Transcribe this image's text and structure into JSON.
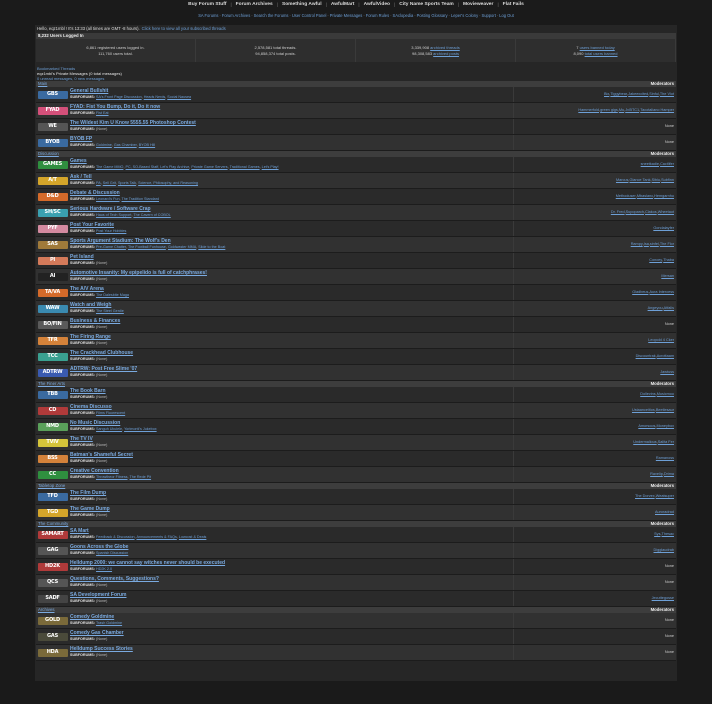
{
  "top_links": [
    "Buy Forum Stuff",
    "Forum Archives",
    "Something Awful",
    "AwfulMart",
    "AwfulVideo",
    "City Name Sports Team",
    "Movieweaver",
    "Flat Fails"
  ],
  "nav_links": [
    "SA Forums",
    "Forum Archives",
    "Search the Forums",
    "User Control Panel",
    "Private Messages",
    "Forum Rules",
    "SAclopedia",
    "Posting Glossary",
    "Leper's Colony",
    "Support",
    "Log Out"
  ],
  "greeting": {
    "text": "Hello, eqz1mbl ! It's 13:33 (all times are GMT -8 hours).",
    "link": "Click here to view all your subscribed threads"
  },
  "stats": {
    "header": "8,232 Users Logged In",
    "cells": [
      {
        "line1": "6,861 registered users logged in.",
        "line2": "111,760 users total."
      },
      {
        "line1": "2,578,581 total threads.",
        "line2": "94,858,374 total posts."
      },
      {
        "line1": "3,339,908",
        "link1": "archived threads",
        "line2": "98,308,583",
        "link2": "archived posts"
      },
      {
        "line1": "7",
        "link1": "users banned today",
        "line2": "8,090",
        "link2": "total users banned"
      }
    ]
  },
  "pm": {
    "bookmarks": "Bookmarked Threads",
    "title": "eqz1mbl's Private Messages (0 total messages)",
    "sub": "0 unread messages, 0 new messages"
  },
  "labels": {
    "moderators": "Moderators",
    "subforums": "SUBFORUMS:",
    "none": "(None)",
    "mods_none": "None"
  },
  "categories": [
    {
      "name": "Main",
      "forums": [
        {
          "tag": "GBS",
          "color": "#3a6aa0",
          "title": "General Bullshit",
          "subforums": [
            "SA's Front Page Discussion",
            "Heads Nerds",
            "Social Nausea"
          ],
          "mods": [
            "Bix",
            "Tiggybear",
            "Jakeexcited",
            "Sinful",
            "The Vlot"
          ]
        },
        {
          "tag": "FYAD",
          "color": "#d4507a",
          "title": "FYAD: Fist You Bump, Do it, Do it now",
          "subforums": [
            "Fist Eat"
          ],
          "mods": [
            "Hammerfold",
            "green gigs",
            "Mu",
            "Jvl5TC1",
            "Tacotaliano Hamper"
          ]
        },
        {
          "tag": "WE",
          "color": "#555555",
          "title": "The Wildest Kim U Know 5555.55 Photoshop Contest",
          "subforums": [],
          "mods": []
        },
        {
          "tag": "BYOB",
          "color": "#3a6aa0",
          "title": "BYOB FP",
          "subforums": [
            "Goldmine",
            "Gas Chamber",
            "BYOB Hill"
          ],
          "mods": []
        }
      ]
    },
    {
      "name": "Discussion",
      "forums": [
        {
          "tag": "GAMES",
          "color": "#2f8f3f",
          "title": "Games",
          "subforums": [
            "The Game MMO",
            "PC, SO-Based Staff, Let's Play Archive",
            "Private Game Servers",
            "Traditional Games",
            "Let's Play!"
          ],
          "mods": [
            "sneetkadie",
            "Cactlifer"
          ]
        },
        {
          "tag": "A/T",
          "color": "#d4a52a",
          "title": "Ask / Tell",
          "subforums": [
            "PA",
            "Sell Grit",
            "Sports Talk",
            "Science, Philosophy, and Reasoning"
          ],
          "mods": [
            "Marcus",
            "Glance Tank",
            "Sibiu",
            "Subfinn"
          ]
        },
        {
          "tag": "D&D",
          "color": "#d46a2a",
          "title": "Debate & Discussion",
          "subforums": [
            "Leonard's Fun",
            "The Tradition Standard"
          ],
          "mods": [
            "Methoduser",
            "Mbaslanc",
            "Hemgarnhu"
          ]
        },
        {
          "tag": "SH/SC",
          "color": "#3aa0b0",
          "title": "Serious Hardware / Software Crap",
          "subforums": [
            "Haus of Tech Support",
            "The Cavern of COBOL"
          ],
          "mods": [
            "Dr. Fred",
            "Supoparch",
            "Clakos",
            "Wheetaot"
          ]
        },
        {
          "tag": "PYF",
          "color": "#d48aa0",
          "title": "Post Your Favorite",
          "subforums": [
            "Post Your Hobbies"
          ],
          "mods": [
            "Gondalayfer"
          ]
        },
        {
          "tag": "SAS",
          "color": "#a07a3a",
          "title": "Sports Argument Stadium: The Wolf's Den",
          "subforums": [
            "Pre-Game Chatter",
            "The Football Funhouse",
            "Goldwaster MMA",
            "Slide to the Boat"
          ],
          "mods": [
            "Rampy",
            "Isa",
            "sinfel",
            "The Flor"
          ]
        },
        {
          "tag": "PI",
          "color": "#d47a5a",
          "title": "Pet Island",
          "subforums": [],
          "mods": [
            "Concey",
            "Thaba"
          ]
        },
        {
          "tag": "AI",
          "color": "#222222",
          "title": "Automotive Insanity: My epipelido is full of catchphrases!",
          "subforums": [],
          "mods": [
            "Mersan"
          ]
        },
        {
          "tag": "TA/VA",
          "color": "#d46a2a",
          "title": "The A/V Arena",
          "subforums": [
            "The Dalesbite Maga"
          ],
          "mods": [
            "Gladbeus",
            "Aura Intercess"
          ]
        },
        {
          "tag": "WAW",
          "color": "#3a8ab0",
          "title": "Watch and Weigh",
          "subforums": [
            "The Steel Gerdie"
          ],
          "mods": [
            "Angeyou",
            "Atfalis"
          ]
        },
        {
          "tag": "BO/FIN",
          "color": "#5a5a5a",
          "title": "Business & Finances",
          "subforums": [],
          "mods": []
        },
        {
          "tag": "TFR",
          "color": "#d4823a",
          "title": "The Firing Range",
          "subforums": [],
          "mods": [
            "Leopold 4 Cker"
          ]
        },
        {
          "tag": "TCC",
          "color": "#3aa090",
          "title": "The Crackhead Clubhouse",
          "subforums": [],
          "mods": [
            "Discountrak",
            "Acrottaam"
          ]
        },
        {
          "tag": "ADTRW",
          "color": "#3a5ab0",
          "title": "ADTRW: Post Free Slime '07",
          "subforums": [],
          "mods": [
            "Jawtuss"
          ]
        }
      ]
    },
    {
      "name": "The Finer Arts",
      "forums": [
        {
          "tag": "TBB",
          "color": "#3a6aa0",
          "title": "The Book Barn",
          "subforums": [],
          "mods": [
            "Dollevins",
            "Musicmoo"
          ]
        },
        {
          "tag": "CD",
          "color": "#b03a3a",
          "title": "Cinema Discusso",
          "subforums": [
            "Films Fluorescent"
          ],
          "mods": [
            "Ustaanceitios",
            "Beetlesaur"
          ]
        },
        {
          "tag": "NMD",
          "color": "#5aa05a",
          "title": "No Music Discussion",
          "subforums": [
            "Sanguh Ukulele",
            "Yorimonti's Jukebox"
          ],
          "mods": [
            "Amorsoos",
            "Moneybox"
          ]
        },
        {
          "tag": "TVIV",
          "color": "#d4c43a",
          "title": "The TV IV",
          "subforums": [],
          "mods": [
            "Undermalious",
            "Salita Fer"
          ]
        },
        {
          "tag": "BSS",
          "color": "#d4823a",
          "title": "Batman's Shameful Secret",
          "subforums": [],
          "mods": [
            "Ramanoss"
          ]
        },
        {
          "tag": "CC",
          "color": "#2f8f3f",
          "title": "Creative Convention",
          "subforums": [
            "Throwtheor Fitness",
            "The Rede Pit"
          ],
          "mods": [
            "Ravelip",
            "Drima"
          ]
        }
      ]
    },
    {
      "name": "Tabletop Zone",
      "forums": [
        {
          "tag": "TFD",
          "color": "#3a6aa0",
          "title": "The Film Dump",
          "subforums": [],
          "mods": [
            "The Dorvex",
            "Weatsuper"
          ]
        },
        {
          "tag": "TGD",
          "color": "#d4a52a",
          "title": "The Game Dump",
          "subforums": [],
          "mods": [
            "Auroradrad"
          ]
        }
      ]
    },
    {
      "name": "The Community",
      "forums": [
        {
          "tag": "SAMART",
          "color": "#b03a3a",
          "title": "SA Mart",
          "subforums": [
            "Feedback & Discussion",
            "Announcements & FAQs",
            "Lowcost & Deals"
          ],
          "mods": [
            "Sys",
            "Thesac"
          ]
        },
        {
          "tag": "GAG",
          "color": "#555555",
          "title": "Goons Across the Globe",
          "subforums": [
            "Spanish Discussion"
          ],
          "mods": [
            "Digglaudrab"
          ]
        },
        {
          "tag": "HD2K",
          "color": "#b03a3a",
          "title": "Helldump 2000: we cannot say witches never should be executed",
          "subforums": [
            "HD2K 2.0"
          ],
          "mods": []
        },
        {
          "tag": "QCS",
          "color": "#555555",
          "title": "Questions, Comments, Suggestions?",
          "subforums": [],
          "mods": []
        },
        {
          "tag": "SADF",
          "color": "#444444",
          "title": "SA Development Forum",
          "subforums": [],
          "mods": [
            "Jecuttegosse"
          ]
        }
      ]
    },
    {
      "name": "Archives",
      "forums": [
        {
          "tag": "GOLD",
          "color": "#7a6a3a",
          "title": "Comedy Goldmine",
          "subforums": [
            "Trash Goldmine"
          ],
          "mods": []
        },
        {
          "tag": "GAS",
          "color": "#4a4a3a",
          "title": "Comedy Gas Chamber",
          "subforums": [],
          "mods": []
        },
        {
          "tag": "HDA",
          "color": "#7a6a3a",
          "title": "Helldump Success Stories",
          "subforums": [],
          "mods": []
        }
      ]
    }
  ]
}
